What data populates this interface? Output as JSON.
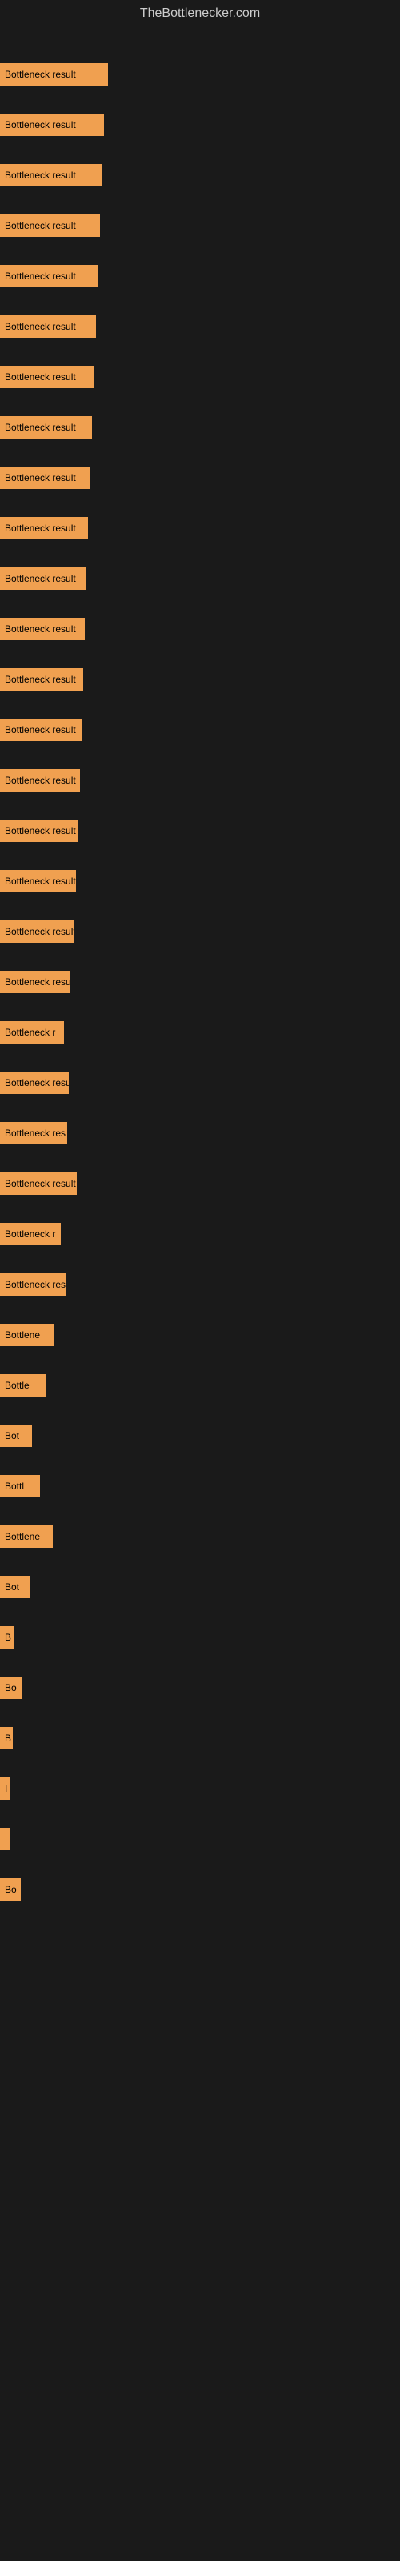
{
  "site": {
    "title": "TheBottlenecker.com"
  },
  "bars": [
    {
      "label": "Bottleneck result",
      "width": 135
    },
    {
      "label": "Bottleneck result",
      "width": 130
    },
    {
      "label": "Bottleneck result",
      "width": 128
    },
    {
      "label": "Bottleneck result",
      "width": 125
    },
    {
      "label": "Bottleneck result",
      "width": 122
    },
    {
      "label": "Bottleneck result",
      "width": 120
    },
    {
      "label": "Bottleneck result",
      "width": 118
    },
    {
      "label": "Bottleneck result",
      "width": 115
    },
    {
      "label": "Bottleneck result",
      "width": 112
    },
    {
      "label": "Bottleneck result",
      "width": 110
    },
    {
      "label": "Bottleneck result",
      "width": 108
    },
    {
      "label": "Bottleneck result",
      "width": 106
    },
    {
      "label": "Bottleneck result",
      "width": 104
    },
    {
      "label": "Bottleneck result",
      "width": 102
    },
    {
      "label": "Bottleneck result",
      "width": 100
    },
    {
      "label": "Bottleneck result",
      "width": 98
    },
    {
      "label": "Bottleneck result",
      "width": 95
    },
    {
      "label": "Bottleneck result",
      "width": 92
    },
    {
      "label": "Bottleneck resu",
      "width": 88
    },
    {
      "label": "Bottleneck r",
      "width": 80
    },
    {
      "label": "Bottleneck resu",
      "width": 86
    },
    {
      "label": "Bottleneck res",
      "width": 84
    },
    {
      "label": "Bottleneck result",
      "width": 96
    },
    {
      "label": "Bottleneck r",
      "width": 76
    },
    {
      "label": "Bottleneck resu",
      "width": 82
    },
    {
      "label": "Bottlene",
      "width": 68
    },
    {
      "label": "Bottle",
      "width": 58
    },
    {
      "label": "Bot",
      "width": 40
    },
    {
      "label": "Bottl",
      "width": 50
    },
    {
      "label": "Bottlene",
      "width": 66
    },
    {
      "label": "Bot",
      "width": 38
    },
    {
      "label": "B",
      "width": 18
    },
    {
      "label": "Bo",
      "width": 28
    },
    {
      "label": "B",
      "width": 16
    },
    {
      "label": "I",
      "width": 10
    },
    {
      "label": "",
      "width": 6
    },
    {
      "label": "Bo",
      "width": 26
    }
  ]
}
